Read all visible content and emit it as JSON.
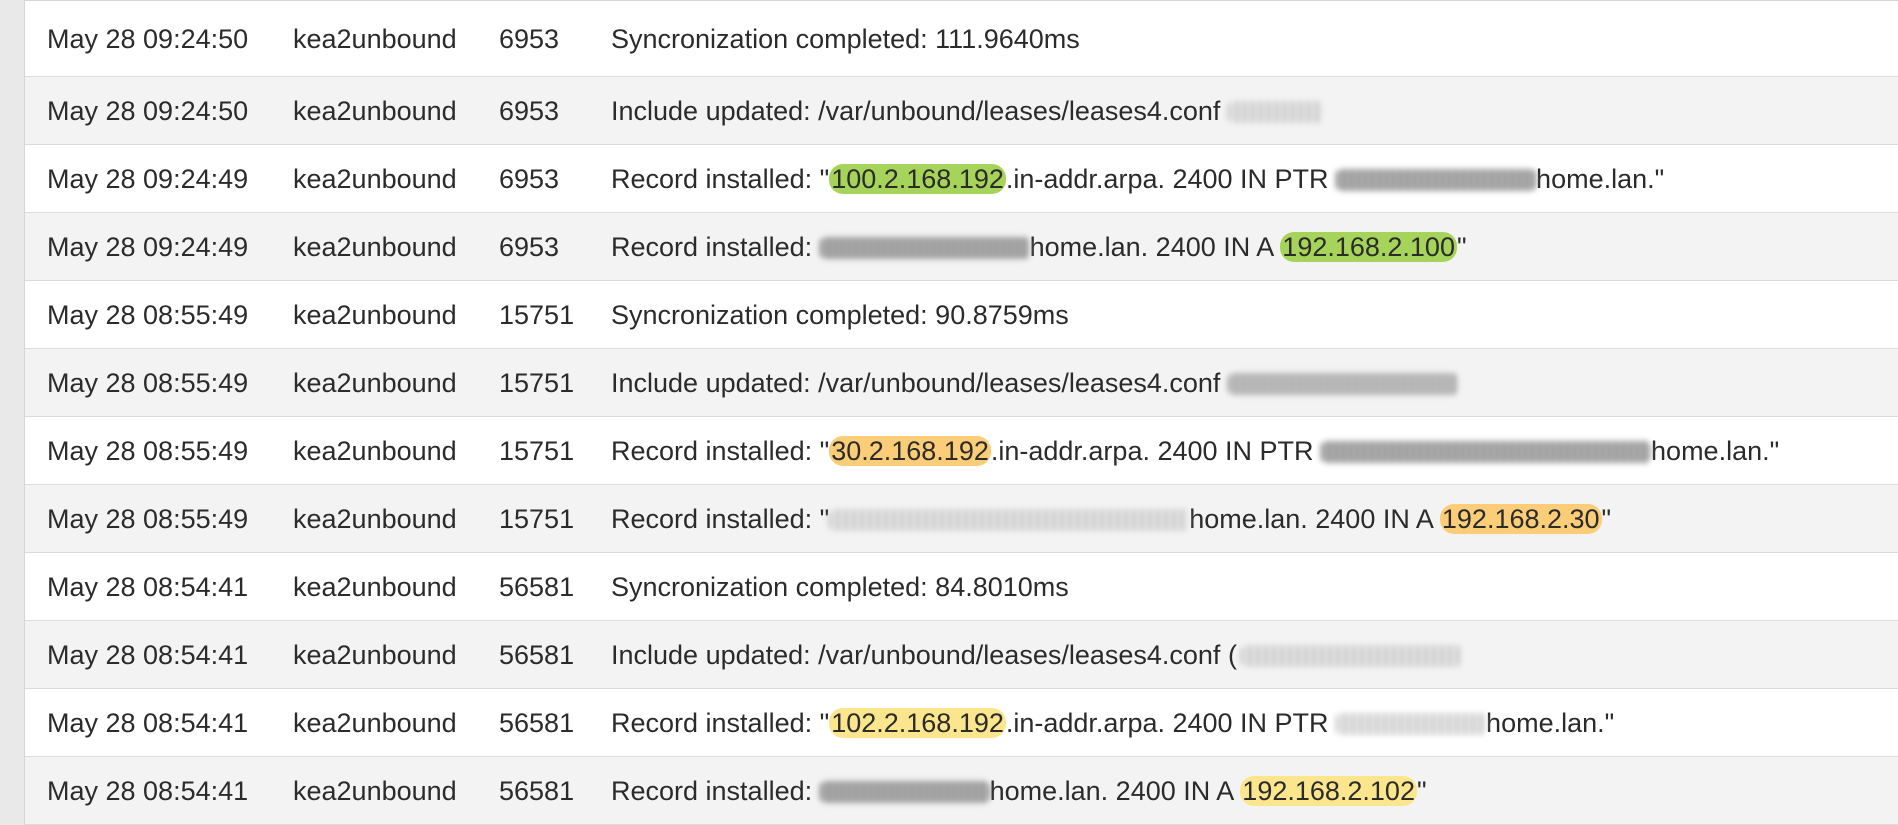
{
  "log": {
    "rows": [
      {
        "date": "May 28 09:24:50",
        "process": "kea2unbound",
        "pid": "6953",
        "message": "Syncronization completed: 111.9640ms"
      },
      {
        "date": "May 28 09:24:50",
        "process": "kea2unbound",
        "pid": "6953",
        "message": "Include updated: /var/unbound/leases/leases4.conf"
      },
      {
        "date": "May 28 09:24:49",
        "process": "kea2unbound",
        "pid": "6953",
        "msg_a": "Record installed: \"",
        "ip": "100.2.168.192",
        "msg_b": ".in-addr.arpa. 2400 IN PTR ",
        "msg_c": "home.lan.\"",
        "highlight": "#a6d45a"
      },
      {
        "date": "May 28 09:24:49",
        "process": "kea2unbound",
        "pid": "6953",
        "msg_a": "Record installed: ",
        "msg_b": "home.lan. 2400 IN A ",
        "ip": "192.168.2.100",
        "msg_c": "\"",
        "highlight": "#a6d45a"
      },
      {
        "date": "May 28 08:55:49",
        "process": "kea2unbound",
        "pid": "15751",
        "message": "Syncronization completed: 90.8759ms"
      },
      {
        "date": "May 28 08:55:49",
        "process": "kea2unbound",
        "pid": "15751",
        "message": "Include updated: /var/unbound/leases/leases4.conf"
      },
      {
        "date": "May 28 08:55:49",
        "process": "kea2unbound",
        "pid": "15751",
        "msg_a": "Record installed: \"",
        "ip": "30.2.168.192",
        "msg_b": ".in-addr.arpa. 2400 IN PTR ",
        "msg_c": "home.lan.\"",
        "highlight": "#fccd78"
      },
      {
        "date": "May 28 08:55:49",
        "process": "kea2unbound",
        "pid": "15751",
        "msg_a": "Record installed: \"",
        "msg_b": "home.lan. 2400 IN A ",
        "ip": "192.168.2.30",
        "msg_c": "\"",
        "highlight": "#fccd78"
      },
      {
        "date": "May 28 08:54:41",
        "process": "kea2unbound",
        "pid": "56581",
        "message": "Syncronization completed: 84.8010ms"
      },
      {
        "date": "May 28 08:54:41",
        "process": "kea2unbound",
        "pid": "56581",
        "message": "Include updated: /var/unbound/leases/leases4.conf ("
      },
      {
        "date": "May 28 08:54:41",
        "process": "kea2unbound",
        "pid": "56581",
        "msg_a": "Record installed: \"",
        "ip": "102.2.168.192",
        "msg_b": ".in-addr.arpa. 2400 IN PTR ",
        "msg_c": "home.lan.\"",
        "highlight": "#fbe68e"
      },
      {
        "date": "May 28 08:54:41",
        "process": "kea2unbound",
        "pid": "56581",
        "msg_a": "Record installed: ",
        "msg_b": "home.lan. 2400 IN A ",
        "ip": "192.168.2.102",
        "msg_c": "\"",
        "highlight": "#fbe68e"
      }
    ]
  }
}
